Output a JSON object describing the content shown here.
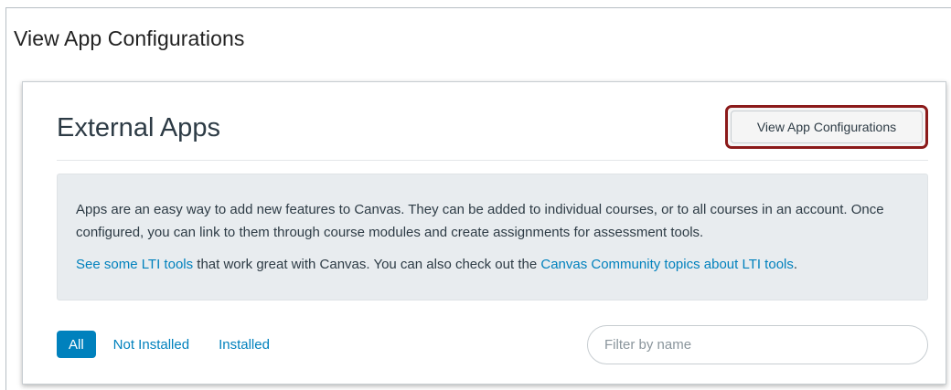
{
  "window": {
    "title": "View App Configurations"
  },
  "panel": {
    "title": "External Apps",
    "view_config_label": "View App Configurations",
    "info": {
      "line1": "Apps are an easy way to add new features to Canvas. They can be added to individual courses, or to all courses in an account. Once configured, you can link to them through course modules and create assignments for assessment tools.",
      "lti_link": "See some LTI tools",
      "line2_middle": " that work great with Canvas. You can also check out the ",
      "community_link": "Canvas Community topics about LTI tools",
      "line2_end": "."
    },
    "tabs": [
      {
        "label": "All",
        "active": true
      },
      {
        "label": "Not Installed",
        "active": false
      },
      {
        "label": "Installed",
        "active": false
      }
    ],
    "filter": {
      "placeholder": "Filter by name",
      "value": ""
    }
  },
  "colors": {
    "link": "#0081bd",
    "highlight_border": "#8b1a1a",
    "info_bg": "#e8ecef"
  }
}
